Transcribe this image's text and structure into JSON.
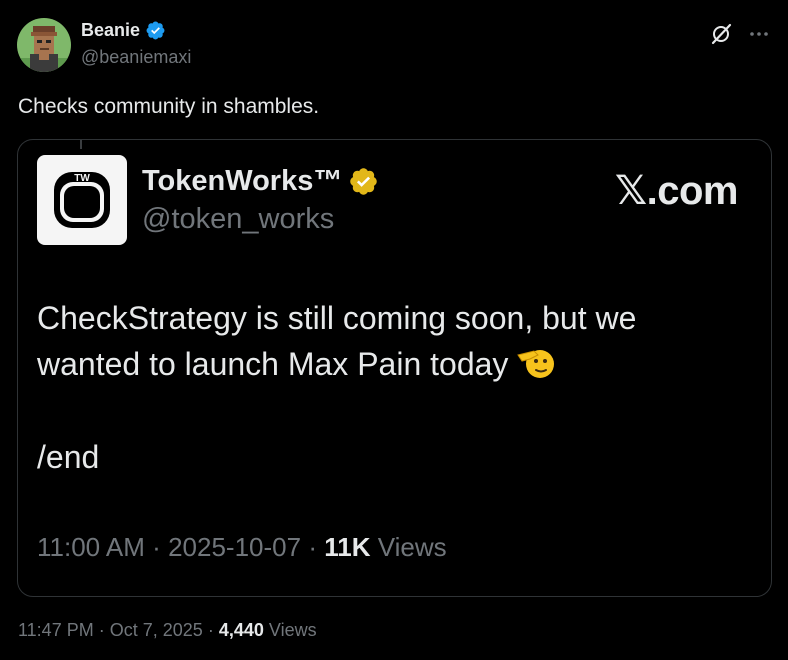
{
  "tweet": {
    "author": {
      "name": "Beanie",
      "handle": "@beaniemaxi",
      "verified_color": "#1d9bf0"
    },
    "text": "Checks community in shambles.",
    "time": "11:47 PM",
    "date": "Oct 7, 2025",
    "views_count": "4,440",
    "views_label": "Views",
    "separator": "·"
  },
  "quoted": {
    "avatar_text": "TW",
    "name": "TokenWorks™",
    "handle": "@token_works",
    "verified_color": "#e2b719",
    "source": "𝕏.com",
    "line1": "CheckStrategy is still coming soon, but we",
    "line2": "wanted to launch Max Pain today",
    "line3": "/end",
    "time": "11:00 AM",
    "date": "2025-10-07",
    "views_count": "11K",
    "views_label": "Views",
    "separator": "·"
  },
  "icons": {
    "grok": "grok-icon",
    "more": "more-icon",
    "verified": "verified-badge-icon",
    "emoji": "saluting-face-emoji"
  },
  "colors": {
    "background": "#000000",
    "text_primary": "#e7e9ea",
    "text_secondary": "#71767b",
    "border": "#2f3336"
  }
}
